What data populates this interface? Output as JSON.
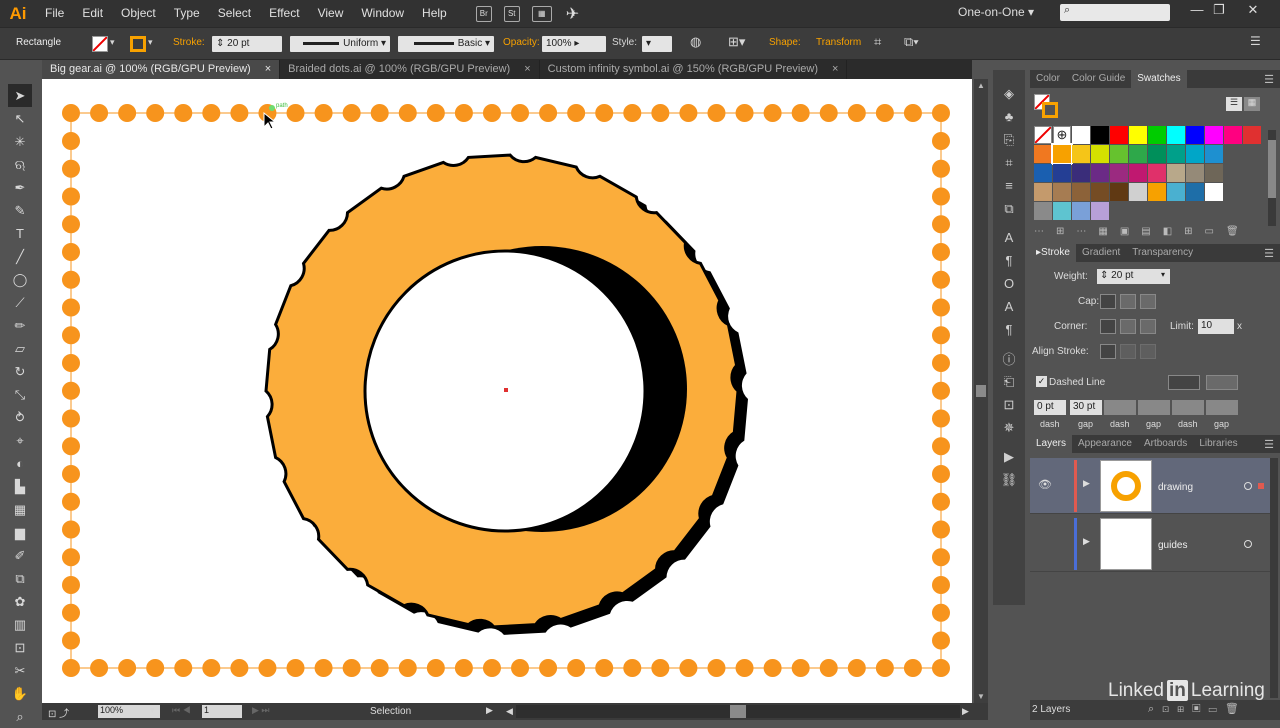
{
  "app": {
    "logo": "Ai",
    "workspace": "One-on-One",
    "search_placeholder": ""
  },
  "menu": [
    "File",
    "Edit",
    "Object",
    "Type",
    "Select",
    "Effect",
    "View",
    "Window",
    "Help"
  ],
  "menu_icons": [
    "Br",
    "St"
  ],
  "control": {
    "tool_name": "Rectangle",
    "stroke_label": "Stroke:",
    "stroke_value": "20 pt",
    "profile": "Uniform",
    "brush": "Basic",
    "opacity_label": "Opacity:",
    "opacity_value": "100%",
    "style_label": "Style:",
    "shape_label": "Shape:",
    "transform_label": "Transform"
  },
  "tabs": [
    {
      "label": "Big gear.ai @ 100% (RGB/GPU Preview)",
      "close": "×"
    },
    {
      "label": "Braided dots.ai @ 100% (RGB/GPU Preview)",
      "close": "×"
    },
    {
      "label": "Custom infinity symbol.ai @ 150% (RGB/GPU Preview)",
      "close": "×"
    }
  ],
  "status": {
    "zoom": "100%",
    "artboard": "1",
    "mode": "Selection"
  },
  "swatch_panel": {
    "tabs": [
      "Color",
      "Color Guide",
      "Swatches"
    ],
    "fill_color": "#f7a100",
    "rows": [
      [
        "#ffffff",
        "#000000",
        "#ff0000",
        "#ffff00",
        "#00cc00",
        "#00ffff",
        "#0000ff",
        "#ff00ff",
        "#ff0080",
        "#e03030"
      ],
      [
        "#f07820",
        "#f7a100",
        "#f5c518",
        "#d4e000",
        "#66c22e",
        "#2ea84a",
        "#008f5a",
        "#00a08a",
        "#00a6c8",
        "#1e90d0"
      ],
      [
        "#1a5fb0",
        "#243e94",
        "#3a2d7a",
        "#6b2a86",
        "#9b2a80",
        "#c01870",
        "#e0306a",
        "#b8a88a",
        "#958a78",
        "#6e6658"
      ],
      [
        "#c49a6c",
        "#a67c52",
        "#8c6239",
        "#754c24",
        "#603913",
        "#d0d0d0",
        "#f7a100",
        "#4ab0d0",
        "#1e6ea8",
        "#ffffff"
      ],
      [
        "#8a8a8a",
        "#5ec4d0",
        "#7aa0d8",
        "#b8a0d8"
      ]
    ]
  },
  "stroke_panel": {
    "tabs": [
      "Stroke",
      "Gradient",
      "Transparency"
    ],
    "weight_label": "Weight:",
    "weight_value": "20 pt",
    "cap_label": "Cap:",
    "corner_label": "Corner:",
    "limit_label": "Limit:",
    "limit_value": "10",
    "limit_unit": "x",
    "align_label": "Align Stroke:",
    "dashed_label": "Dashed Line",
    "dash_values": [
      "0 pt",
      "30 pt",
      "",
      "",
      "",
      ""
    ],
    "dash_labels": [
      "dash",
      "gap",
      "dash",
      "gap",
      "dash",
      "gap"
    ]
  },
  "layers_panel": {
    "tabs": [
      "Layers",
      "Appearance",
      "Artboards",
      "Libraries"
    ],
    "layers": [
      {
        "name": "drawing",
        "color": "#e05a50"
      },
      {
        "name": "guides",
        "color": "#4a6ed8"
      }
    ],
    "count": "2 Layers"
  },
  "watermark": {
    "brand_a": "Linked",
    "brand_b": "in",
    "brand_c": "Learning"
  },
  "canvas": {
    "cursor_hint": "path"
  }
}
